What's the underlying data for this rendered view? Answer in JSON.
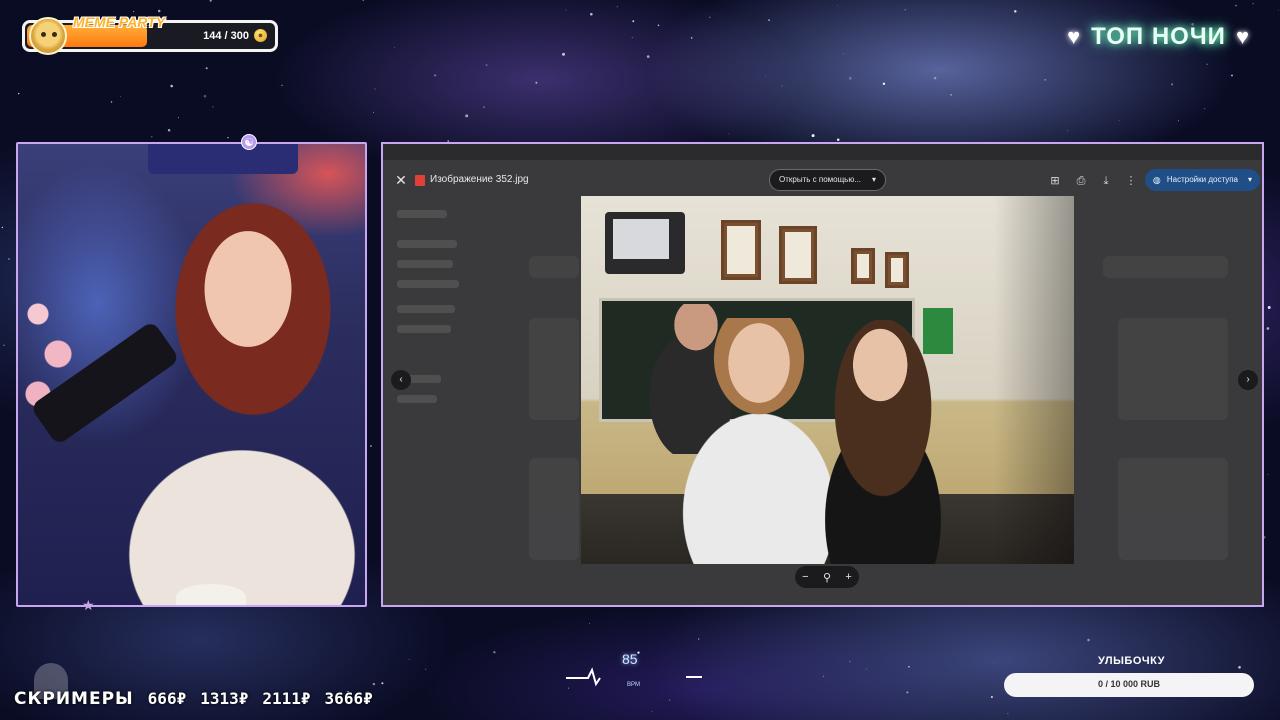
{
  "meme_party": {
    "title": "MEME PARTY",
    "count": "144 / 300",
    "progress": 0.48,
    "icon": "doge-icon",
    "coin_icon": "coin-icon"
  },
  "top_right": {
    "title": "ТОП НОЧИ",
    "heart_left": "♥",
    "heart_right": "♥"
  },
  "viewer": {
    "file_name": "Изображение 352.jpg",
    "open_with": "Открыть с помощью...",
    "share": "Настройки доступа",
    "close_glyph": "✕",
    "prev_glyph": "‹",
    "next_glyph": "›",
    "zoom_out": "−",
    "zoom_icon": "⚲",
    "zoom_in": "+",
    "icons": [
      "add-comment-icon",
      "print-icon",
      "download-icon",
      "more-icon"
    ]
  },
  "screamers": {
    "label": "СКРИМЕРЫ",
    "values": [
      "666₽",
      "1313₽",
      "2111₽",
      "3666₽"
    ]
  },
  "heart_rate": {
    "value": "85",
    "unit": "BPM"
  },
  "goal": {
    "label": "УЛЫБОЧКУ",
    "text": "0 / 10 000 RUB",
    "progress": 0,
    "fill_color": "#ff7a9c"
  },
  "colors": {
    "frame_border": "#c9a6f0",
    "share_button": "#1f4f86",
    "top_title_glow": "#7affc4"
  }
}
